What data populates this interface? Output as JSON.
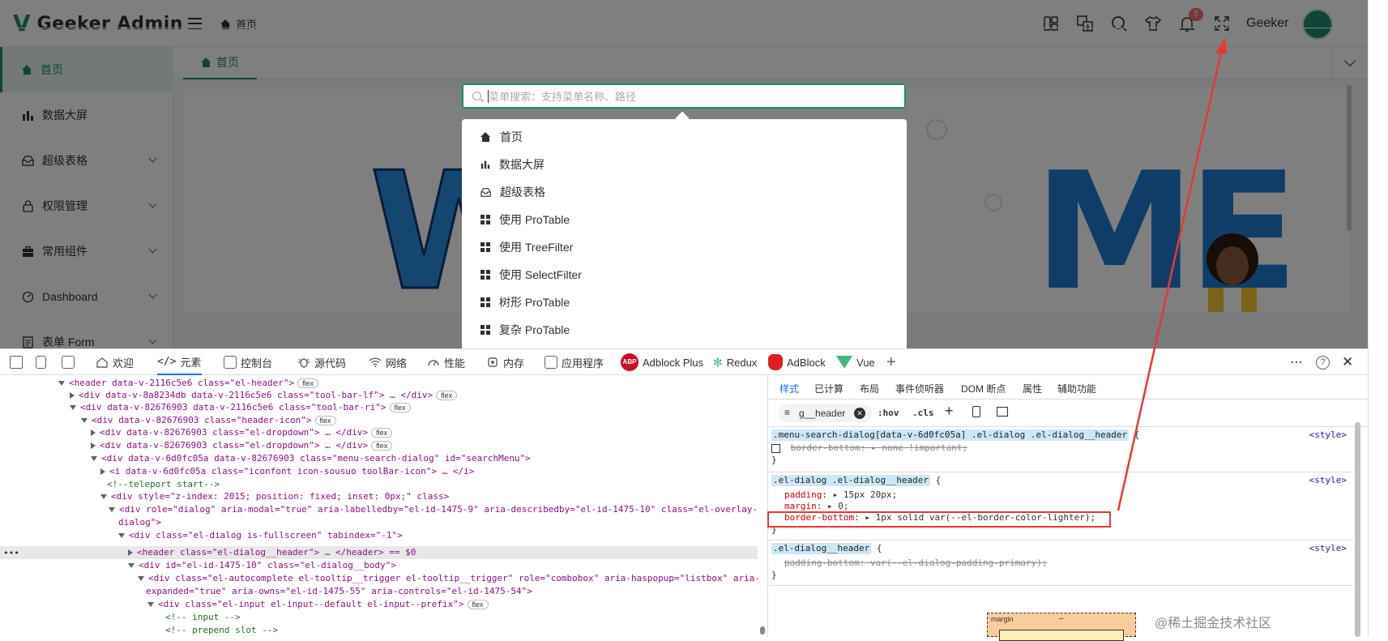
{
  "app": {
    "logo_text": "Geeker Admin",
    "breadcrumb": "首页",
    "user_name": "Geeker",
    "notification_count": "5"
  },
  "sidebar": {
    "items": [
      {
        "label": "首页",
        "icon": "home-icon",
        "active": true
      },
      {
        "label": "数据大屏",
        "icon": "bar-chart-icon"
      },
      {
        "label": "超级表格",
        "icon": "table-icon"
      },
      {
        "label": "权限管理",
        "icon": "lock-icon"
      },
      {
        "label": "常用组件",
        "icon": "briefcase-icon"
      },
      {
        "label": "Dashboard",
        "icon": "dashboard-icon"
      },
      {
        "label": "表单 Form",
        "icon": "form-icon"
      }
    ]
  },
  "tabs": {
    "home_label": "首页"
  },
  "search": {
    "placeholder": "菜单搜索：支持菜单名称、路径",
    "results": [
      {
        "label": "首页",
        "icon": "home-icon"
      },
      {
        "label": "数据大屏",
        "icon": "bar-chart-icon"
      },
      {
        "label": "超级表格",
        "icon": "table-icon"
      },
      {
        "label": "使用 ProTable",
        "icon": "grid-icon"
      },
      {
        "label": "使用 TreeFilter",
        "icon": "grid-icon"
      },
      {
        "label": "使用 SelectFilter",
        "icon": "grid-icon"
      },
      {
        "label": "树形 ProTable",
        "icon": "grid-icon"
      },
      {
        "label": "复杂 ProTable",
        "icon": "grid-icon"
      }
    ]
  },
  "devtools": {
    "tabs": [
      "欢迎",
      "元素",
      "控制台",
      "源代码",
      "网络",
      "性能",
      "内存",
      "应用程序",
      "Adblock Plus",
      "Redux",
      "AdBlock",
      "Vue"
    ],
    "styles_tabs": [
      "样式",
      "已计算",
      "布局",
      "事件侦听器",
      "DOM 断点",
      "属性",
      "辅助功能"
    ],
    "filter_value": "g__header",
    "hov": ":hov",
    "cls": ".cls",
    "dom_lines": [
      {
        "html": "&lt;header data-v-2116c5e6 class=\"el-header\"&gt;",
        "pill": "flex"
      },
      {
        "html": "&lt;div data-v-8a8234db data-v-2116c5e6 class=\"tool-bar-lf\"&gt; … &lt;/div&gt;",
        "pill": "flex"
      },
      {
        "html": "&lt;div data-v-82676903 data-v-2116c5e6 class=\"tool-bar-ri\"&gt;",
        "pill": "flex"
      },
      {
        "html": "&lt;div data-v-82676903 class=\"header-icon\"&gt;",
        "pill": "flex"
      },
      {
        "html": "&lt;div data-v-82676903 class=\"el-dropdown\"&gt; … &lt;/div&gt;",
        "pill": "flex"
      },
      {
        "html": "&lt;div data-v-82676903 class=\"el-dropdown\"&gt; … &lt;/div&gt;",
        "pill": "flex"
      },
      {
        "html": "&lt;div data-v-6d0fc05a data-v-82676903 class=\"menu-search-dialog\" id=\"searchMenu\"&gt;",
        "pill": ""
      },
      {
        "html": "&lt;i data-v-6d0fc05a class=\"iconfont icon-sousuo toolBar-icon\"&gt; … &lt;/i&gt;",
        "pill": ""
      },
      {
        "html": "&lt;!--teleport start--&gt;",
        "pill": ""
      },
      {
        "html": "&lt;div style=\"z-index: 2015; position: fixed; inset: 0px;\" class&gt;",
        "pill": ""
      },
      {
        "html": "&lt;div role=\"dialog\" aria-modal=\"true\" aria-labelledby=\"el-id-1475-9\" aria-describedby=\"el-id-1475-10\" class=\"el-overlay-",
        "pill": ""
      },
      {
        "html": "dialog\"&gt;",
        "pill": ""
      },
      {
        "html": "&lt;div class=\"el-dialog is-fullscreen\" tabindex=\"-1\"&gt;",
        "pill": ""
      },
      {
        "html": "&lt;header class=\"el-dialog__header\"&gt; … &lt;/header&gt; == $0",
        "pill": ""
      },
      {
        "html": "&lt;div id=\"el-id-1475-10\" class=\"el-dialog__body\"&gt;",
        "pill": ""
      },
      {
        "html": "&lt;div class=\"el-autocomplete el-tooltip__trigger el-tooltip__trigger\" role=\"combobox\" aria-haspopup=\"listbox\" aria-",
        "pill": ""
      },
      {
        "html": "expanded=\"true\" aria-owns=\"el-id-1475-55\" aria-controls=\"el-id-1475-54\"&gt;",
        "pill": ""
      },
      {
        "html": "&lt;div class=\"el-input el-input--default el-input--prefix\"&gt;",
        "pill": "flex"
      },
      {
        "html": "&lt;!-- input --&gt;",
        "pill": ""
      },
      {
        "html": "&lt;!-- prepend slot --&gt;",
        "pill": ""
      }
    ],
    "rules": [
      {
        "selector": ".menu-search-dialog[data-v-6d0fc05a] .el-dialog .el-dialog__header",
        "source": "<style>",
        "props": [
          {
            "name": "border-bottom",
            "value": "none !important;",
            "struck": true
          }
        ]
      },
      {
        "selector": ".el-dialog .el-dialog__header",
        "source": "<style>",
        "props": [
          {
            "name": "padding",
            "value": "15px 20px;",
            "struck": false
          },
          {
            "name": "margin",
            "value": "0;",
            "struck": false
          },
          {
            "name": "border-bottom",
            "value": "1px solid  var(--el-border-color-lighter);",
            "struck": false
          }
        ]
      },
      {
        "selector": ".el-dialog__header",
        "source": "<style>",
        "props": [
          {
            "name": "padding-bottom",
            "value": "var(--el-dialog-padding-primary);",
            "struck": true
          }
        ]
      }
    ],
    "box_label": "margin",
    "box_value": "–"
  },
  "watermark": "@稀土掘金技术社区",
  "colors": {
    "accent": "#1f8a70",
    "highlight_red": "#e53935",
    "devtools_blue": "#1a73e8"
  }
}
